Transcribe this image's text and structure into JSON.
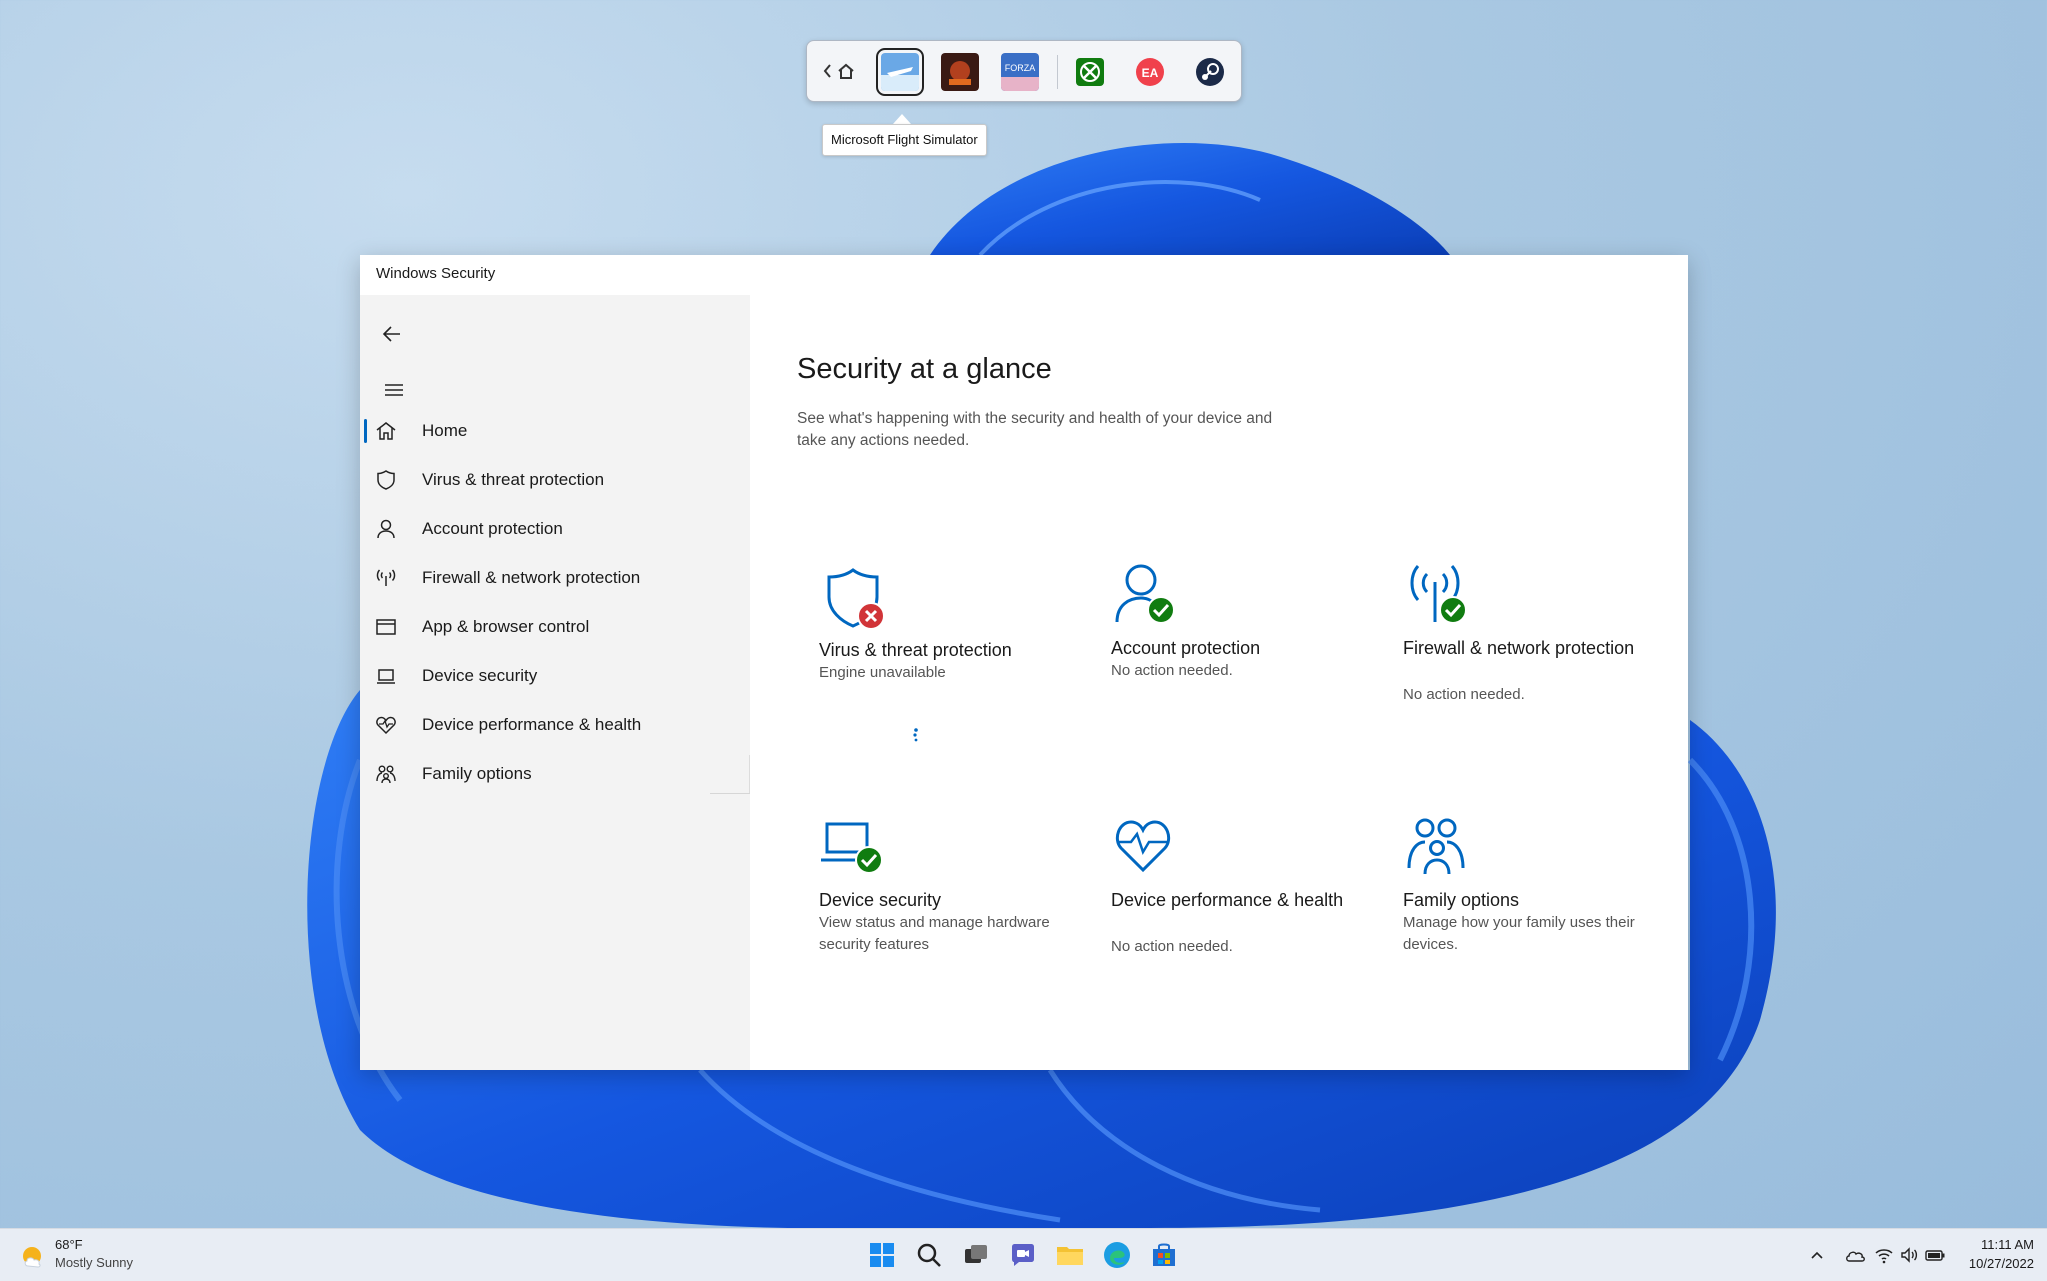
{
  "tooltip": {
    "text": "Microsoft Flight Simulator"
  },
  "window": {
    "title": "Windows Security"
  },
  "sidebar": {
    "items": [
      {
        "label": "Home",
        "icon": "home-icon",
        "active": true
      },
      {
        "label": "Virus & threat protection",
        "icon": "shield-icon"
      },
      {
        "label": "Account protection",
        "icon": "person-icon"
      },
      {
        "label": "Firewall & network protection",
        "icon": "antenna-icon"
      },
      {
        "label": "App & browser control",
        "icon": "browser-window-icon"
      },
      {
        "label": "Device security",
        "icon": "laptop-icon"
      },
      {
        "label": "Device performance & health",
        "icon": "heart-pulse-icon"
      },
      {
        "label": "Family options",
        "icon": "family-icon"
      }
    ]
  },
  "main": {
    "title": "Security at a glance",
    "subtitle": "See what's happening with the security and health of your device and take any actions needed.",
    "cards": [
      {
        "title": "Virus & threat protection",
        "desc": "Engine unavailable",
        "status": "error"
      },
      {
        "title": "Account protection",
        "desc": "No action needed.",
        "status": "ok"
      },
      {
        "title": "Firewall & network protection",
        "desc": "No action needed.",
        "status": "ok"
      },
      {
        "title": "Device security",
        "desc": "View status and manage hardware security features",
        "status": "ok"
      },
      {
        "title": "Device performance & health",
        "desc": "No action needed.",
        "status": "none"
      },
      {
        "title": "Family options",
        "desc": "Manage how your family uses their devices.",
        "status": "none"
      }
    ]
  },
  "taskbar": {
    "weather_temp": "68°F",
    "weather_desc": "Mostly Sunny",
    "time": "11:11 AM",
    "date": "10/27/2022"
  },
  "colors": {
    "accent": "#0067c0",
    "ok": "#107c10",
    "error": "#d13438"
  }
}
